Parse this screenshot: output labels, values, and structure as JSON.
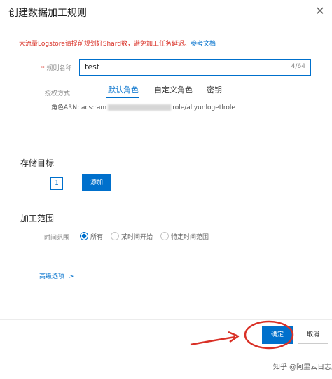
{
  "dialog": {
    "title": "创建数据加工规则",
    "close_glyph": "✕"
  },
  "warning": {
    "text": "大流量Logstore请提前规划好Shard数，避免加工任务延迟。",
    "link": "参考文档"
  },
  "rule_name": {
    "label": "规则名称",
    "required_mark": "*",
    "value": "test",
    "counter": "4/64"
  },
  "auth": {
    "label": "授权方式",
    "tabs": [
      {
        "label": "默认角色",
        "active": true
      },
      {
        "label": "自定义角色",
        "active": false
      },
      {
        "label": "密钥",
        "active": false
      }
    ],
    "arn_prefix": "角色ARN: acs:ram",
    "arn_suffix": "role/aliyunlogetlrole"
  },
  "storage": {
    "title": "存储目标",
    "step_number": "1",
    "add_label": "添加"
  },
  "range": {
    "title": "加工范围",
    "label": "时间范围",
    "options": [
      {
        "label": "所有",
        "selected": true
      },
      {
        "label": "某时间开始",
        "selected": false
      },
      {
        "label": "特定时间范围",
        "selected": false
      }
    ]
  },
  "advanced": {
    "label": "高级选项",
    "chevron": ">"
  },
  "footer": {
    "confirm_label": "确定",
    "cancel_label": "取消"
  },
  "watermark": "知乎 @阿里云日志服务",
  "colors": {
    "accent": "#0070cc",
    "warning": "#d93026",
    "annotation": "#d93026"
  }
}
